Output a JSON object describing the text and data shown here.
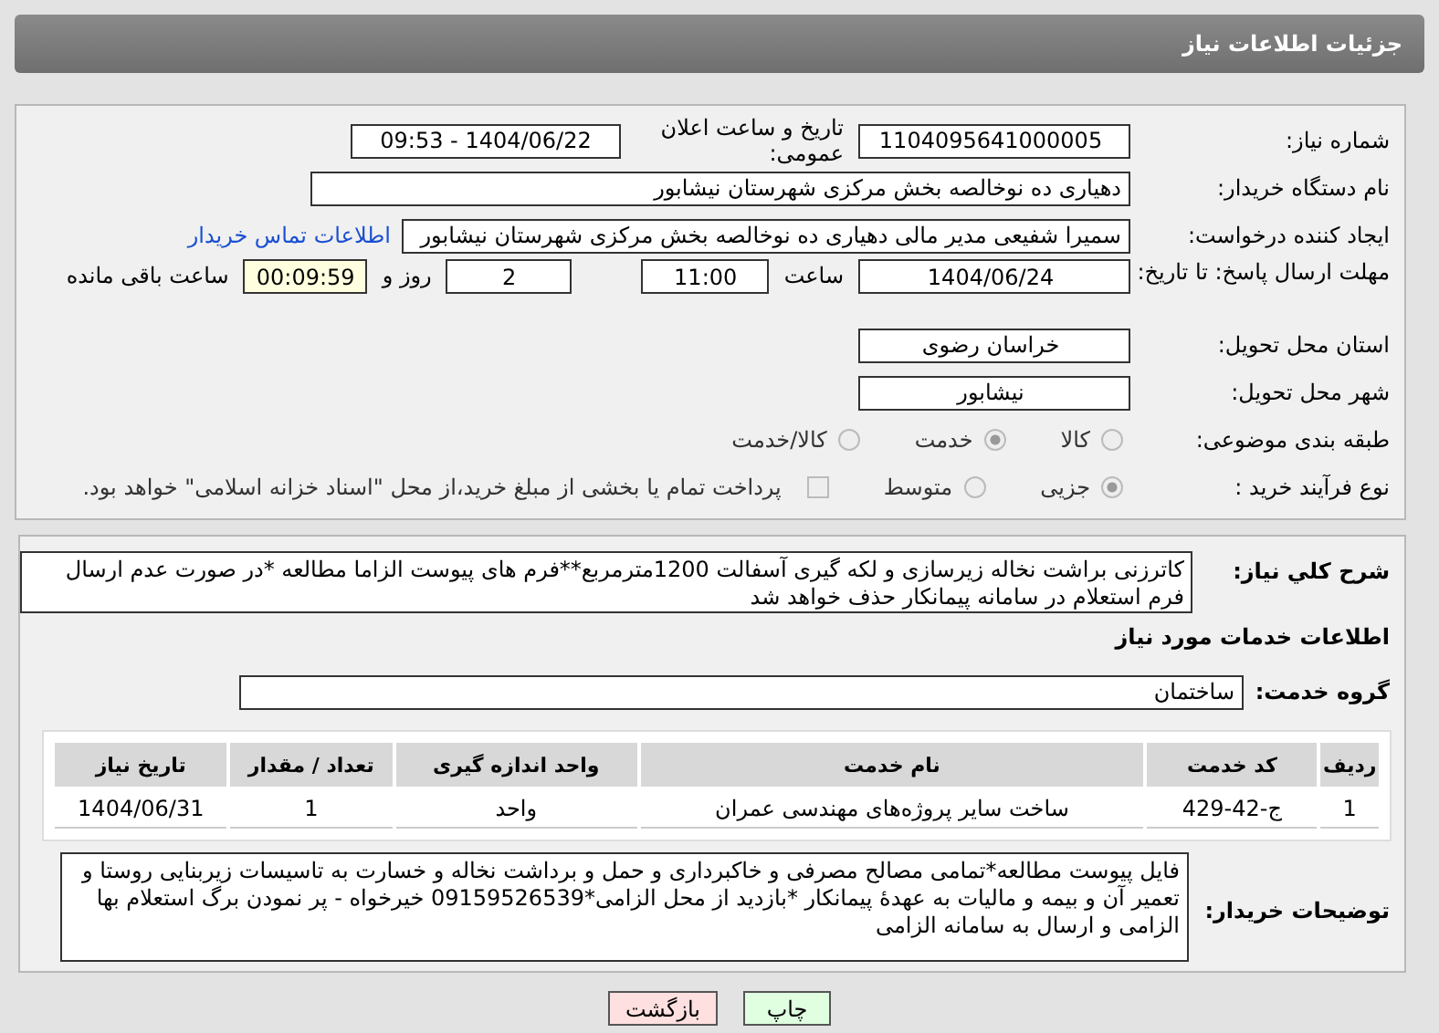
{
  "header": {
    "title": "جزئیات اطلاعات نیاز"
  },
  "need_number": {
    "label": "شماره نیاز:",
    "value": "1104095641000005"
  },
  "announce": {
    "label": "تاریخ و ساعت اعلان عمومی:",
    "value": "1404/06/22 - 09:53"
  },
  "buyer": {
    "label": "نام دستگاه خریدار:",
    "value": "دهیاری ده نوخالصه بخش مرکزی شهرستان نیشابور"
  },
  "creator": {
    "label": "ایجاد کننده درخواست:",
    "value": "سمیرا شفیعی مدیر مالی دهیاری ده نوخالصه بخش مرکزی شهرستان نیشابور",
    "link": "اطلاعات تماس خریدار"
  },
  "deadline": {
    "label": "مهلت ارسال پاسخ: تا تاریخ:",
    "date": "1404/06/24",
    "time_label": "ساعت",
    "time": "11:00",
    "days": "2",
    "days_label": "روز و",
    "remaining": "00:09:59",
    "remaining_label": "ساعت باقی مانده"
  },
  "province": {
    "label": "استان محل تحویل:",
    "value": "خراسان رضوی"
  },
  "city": {
    "label": "شهر محل تحویل:",
    "value": "نیشابور"
  },
  "category": {
    "label": "طبقه بندی موضوعی:",
    "options": [
      {
        "label": "کالا",
        "selected": false
      },
      {
        "label": "خدمت",
        "selected": true
      },
      {
        "label": "کالا/خدمت",
        "selected": false
      }
    ]
  },
  "process": {
    "label": "نوع فرآیند خرید :",
    "options": [
      {
        "label": "جزیی",
        "selected": true
      },
      {
        "label": "متوسط",
        "selected": false
      }
    ],
    "payment": {
      "label": "پرداخت تمام یا بخشی از مبلغ خرید،از محل \"اسناد خزانه اسلامی\" خواهد بود.",
      "checked": false
    }
  },
  "description": {
    "label": "شرح کلي نياز:",
    "value": "کاترزنی براشت نخاله زیرسازی و لکه گیری آسفالت 1200مترمربع**فرم های پیوست الزاما مطالعه *در صورت عدم ارسال فرم استعلام در سامانه پیمانکار حذف خواهد شد"
  },
  "services_title": "اطلاعات خدمات مورد نیاز",
  "service_group": {
    "label": "گروه خدمت:",
    "value": "ساختمان"
  },
  "table": {
    "columns": [
      "ردیف",
      "کد خدمت",
      "نام خدمت",
      "واحد اندازه گیری",
      "تعداد / مقدار",
      "تاریخ نیاز"
    ],
    "rows": [
      [
        "1",
        "ج-42-429",
        "ساخت سایر پروژه‌های مهندسی عمران",
        "واحد",
        "1",
        "1404/06/31"
      ]
    ]
  },
  "buyer_notes": {
    "label": "توضیحات خریدار:",
    "value": "فایل پیوست مطالعه*تمامی مصالح مصرفی و خاکبرداری و حمل و برداشت نخاله و خسارت به تاسیسات زیربنایی روستا و تعمیر آن و بیمه و مالیات به عهدهٔ پیمانکار *بازدید از محل الزامی*09159526539 خیرخواه - پر نمودن برگ استعلام بها الزامی و ارسال به سامانه الزامی"
  },
  "buttons": [
    {
      "label": "چاپ",
      "kind": "print"
    },
    {
      "label": "بازگشت",
      "kind": "back"
    }
  ]
}
